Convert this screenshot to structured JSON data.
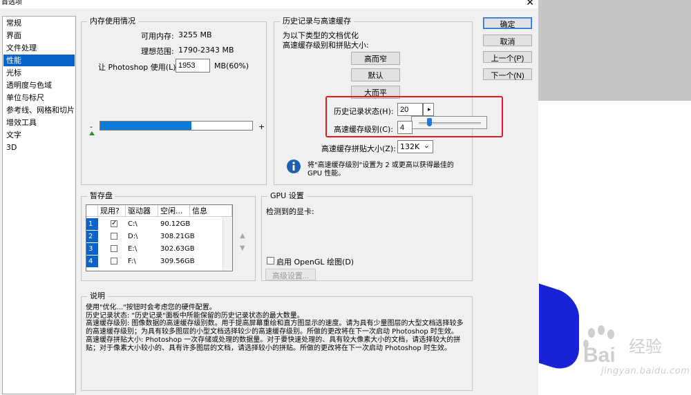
{
  "window": {
    "title": "首选项",
    "close_glyph": "✕"
  },
  "nav": {
    "items": [
      {
        "label": "常规",
        "selected": false
      },
      {
        "label": "界面",
        "selected": false
      },
      {
        "label": "文件处理",
        "selected": false
      },
      {
        "label": "性能",
        "selected": true
      },
      {
        "label": "光标",
        "selected": false
      },
      {
        "label": "透明度与色域",
        "selected": false
      },
      {
        "label": "单位与标尺",
        "selected": false
      },
      {
        "label": "参考线、网格和切片",
        "selected": false
      },
      {
        "label": "增效工具",
        "selected": false
      },
      {
        "label": "文字",
        "selected": false
      },
      {
        "label": "3D",
        "selected": false
      }
    ]
  },
  "memory": {
    "title": "内存使用情况",
    "available_label": "可用内存:",
    "available_value": "3255 MB",
    "ideal_label": "理想范围:",
    "ideal_value": "1790-2343 MB",
    "let_label": "让 Photoshop 使用(L):",
    "let_value": "1953",
    "let_unit": "MB(60%)",
    "minus": "-",
    "plus": "+",
    "slider_fraction": 0.6
  },
  "history": {
    "title": "历史记录与高速缓存",
    "intro_line1": "为以下类型的文档优化",
    "intro_line2": "高速缓存级别和拼贴大小:",
    "btn_tall_thin": "高而窄",
    "btn_default": "默认",
    "btn_big_flat": "大而平",
    "states_label": "历史记录状态(H):",
    "states_value": "20",
    "cache_levels_label": "高速缓存级别(C):",
    "cache_levels_value": "4",
    "tile_size_label": "高速缓存拼贴大小(Z):",
    "tile_size_value": "132K",
    "info_line1": "将\"高速缓存级别\"设置为 2 或更高以获得最佳的",
    "info_line2": "GPU 性能。",
    "arrow_glyph": "▸",
    "dropdown_glyph": "⌄"
  },
  "buttons": {
    "ok": "确定",
    "cancel": "取消",
    "prev": "上一个(P)",
    "next": "下一个(N)"
  },
  "scratch": {
    "title": "暂存盘",
    "columns": [
      "现用?",
      "驱动器",
      "空闲...",
      "信息"
    ],
    "rows": [
      {
        "index": "1",
        "active": true,
        "check": "✓",
        "drive": "C:\\",
        "free": "90.12GB"
      },
      {
        "index": "2",
        "active": false,
        "check": "",
        "drive": "D:\\",
        "free": "308.21GB"
      },
      {
        "index": "3",
        "active": false,
        "check": "",
        "drive": "E:\\",
        "free": "302.63GB"
      },
      {
        "index": "4",
        "active": false,
        "check": "",
        "drive": "F:\\",
        "free": "309.56GB"
      }
    ],
    "up_glyph": "▲",
    "down_glyph": "▼"
  },
  "gpu": {
    "title": "GPU 设置",
    "detected_label": "检测到的显卡:",
    "opengl_label": "启用 OpenGL 绘图(D)",
    "advanced_label": "高级设置..."
  },
  "description": {
    "title": "说明",
    "lines": [
      "使用\"优化...\"按钮时会考虑您的硬件配置。",
      "历史记录状态: \"历史记录\"面板中所能保留的历史记录状态的最大数量。",
      "高速缓存级别: 图像数据的高速缓存级别数。用于提高屏幕重绘和直方图显示的速度。请为具有少量图层的大型文档选择较多的高速缓存级别；为具有较多图层的小型文档选择较少的高速缓存级别。所做的更改将在下一次启动 Photoshop 时生效。",
      "高速缓存拼贴大小: Photoshop 一次存储或处理的数据量。对于要快速处理的、具有较大像素大小的文档，请选择较大的拼贴；对于像素大小较小的、具有许多图层的文档，请选择较小的拼贴。所做的更改将在下一次启动 Photoshop 时生效。"
    ]
  },
  "watermark": {
    "brand": "Bai",
    "brand_cn": "经验",
    "url": "jingyan.baidu.com"
  },
  "colors": {
    "selection": "#0a64c8",
    "slider_fill": "#0a7cd8",
    "highlight_box": "#e8191d",
    "brand_blue": "#1a22d6"
  }
}
